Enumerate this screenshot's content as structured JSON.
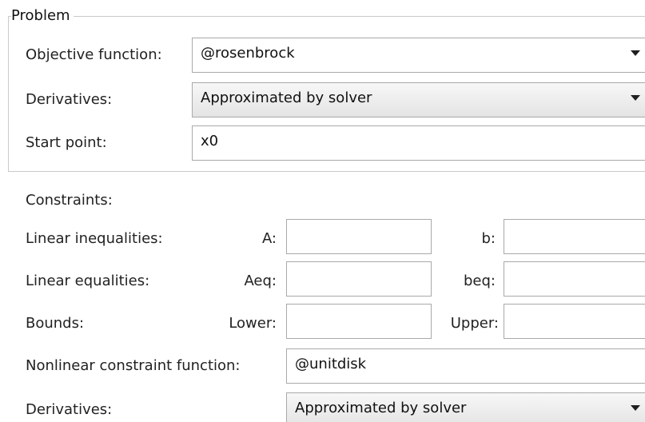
{
  "problem": {
    "title": "Problem",
    "objective": {
      "label": "Objective function:",
      "value": "@rosenbrock",
      "icon": "chevron-down-icon"
    },
    "derivatives": {
      "label": "Derivatives:",
      "value": "Approximated by solver",
      "icon": "chevron-down-icon"
    },
    "start_point": {
      "label": "Start point:",
      "value": "x0"
    }
  },
  "constraints": {
    "title": "Constraints:",
    "linear_inequalities": {
      "label": "Linear inequalities:",
      "a_label": "A:",
      "a_value": "",
      "b_label": "b:",
      "b_value": ""
    },
    "linear_equalities": {
      "label": "Linear equalities:",
      "aeq_label": "Aeq:",
      "aeq_value": "",
      "beq_label": "beq:",
      "beq_value": ""
    },
    "bounds": {
      "label": "Bounds:",
      "lower_label": "Lower:",
      "lower_value": "",
      "upper_label": "Upper:",
      "upper_value": ""
    },
    "nonlinear": {
      "label": "Nonlinear constraint function:",
      "value": "@unitdisk"
    },
    "derivatives": {
      "label": "Derivatives:",
      "value": "Approximated by solver",
      "icon": "chevron-down-icon"
    }
  }
}
